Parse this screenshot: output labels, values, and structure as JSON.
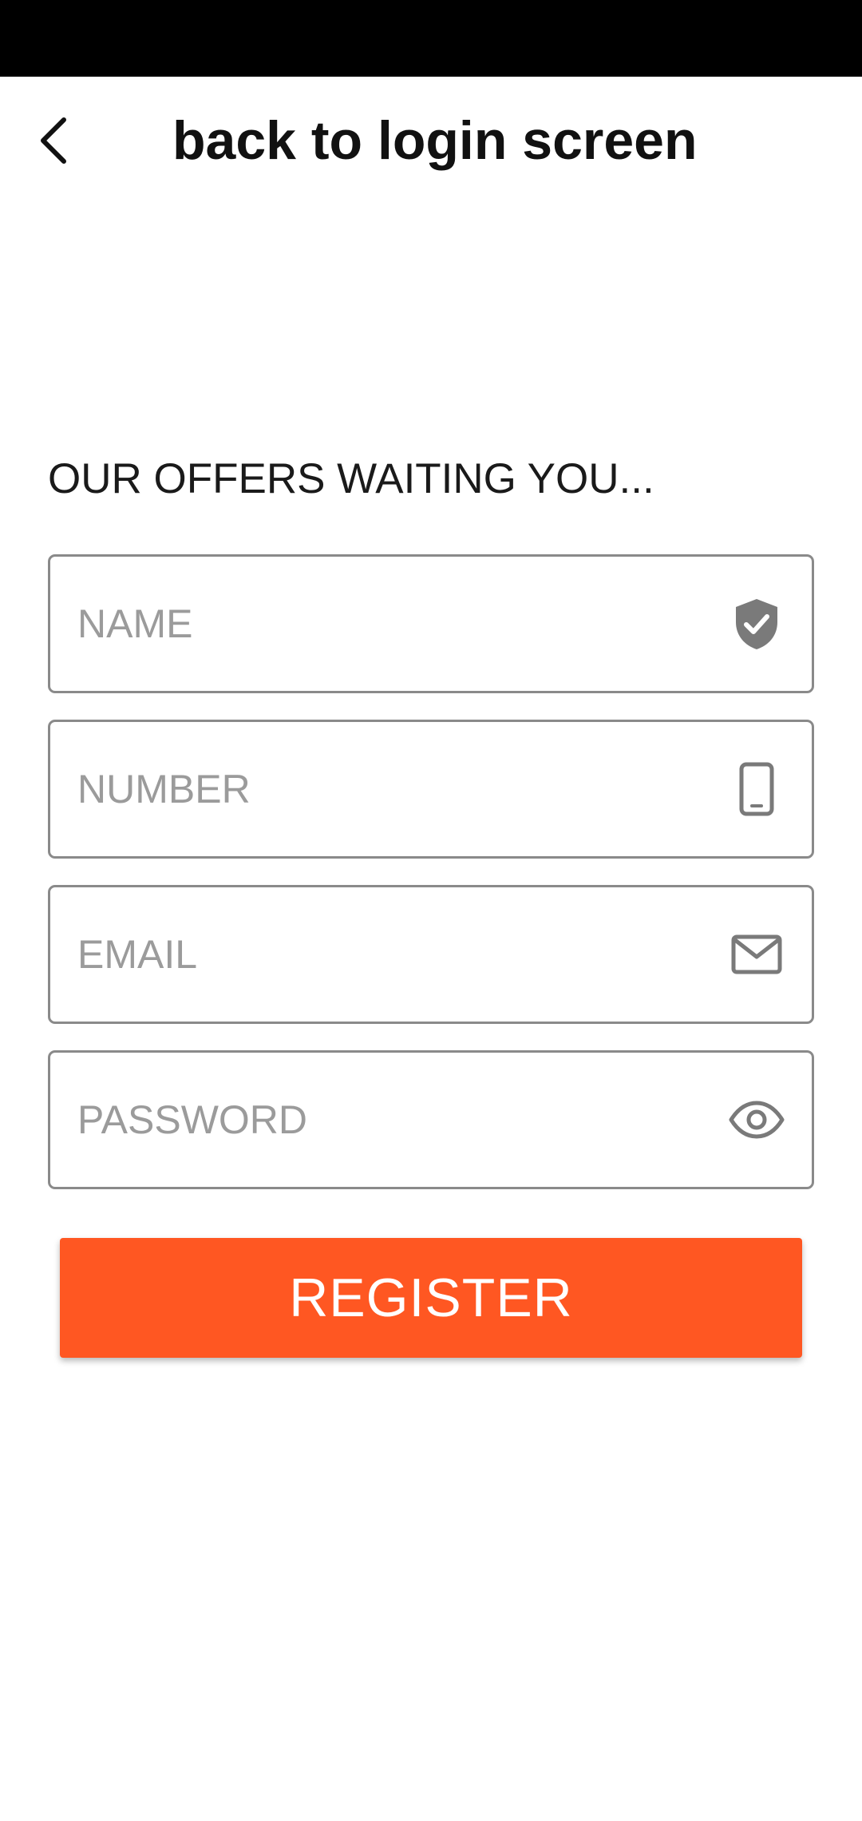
{
  "toolbar": {
    "title": "back to login screen",
    "back_icon": "chevron-left-icon"
  },
  "form": {
    "heading": "OUR OFFERS WAITING YOU...",
    "fields": [
      {
        "placeholder": "NAME",
        "value": "",
        "icon": "shield-check-icon"
      },
      {
        "placeholder": "NUMBER",
        "value": "",
        "icon": "mobile-phone-icon"
      },
      {
        "placeholder": "EMAIL",
        "value": "",
        "icon": "envelope-icon"
      },
      {
        "placeholder": "PASSWORD",
        "value": "",
        "icon": "eye-icon"
      }
    ],
    "register_label": "REGISTER"
  },
  "colors": {
    "accent": "#ff5722",
    "status_bar": "#000000",
    "field_border": "#8a8a8a",
    "placeholder": "#9b9b9b",
    "icon": "#7a7a7a"
  }
}
